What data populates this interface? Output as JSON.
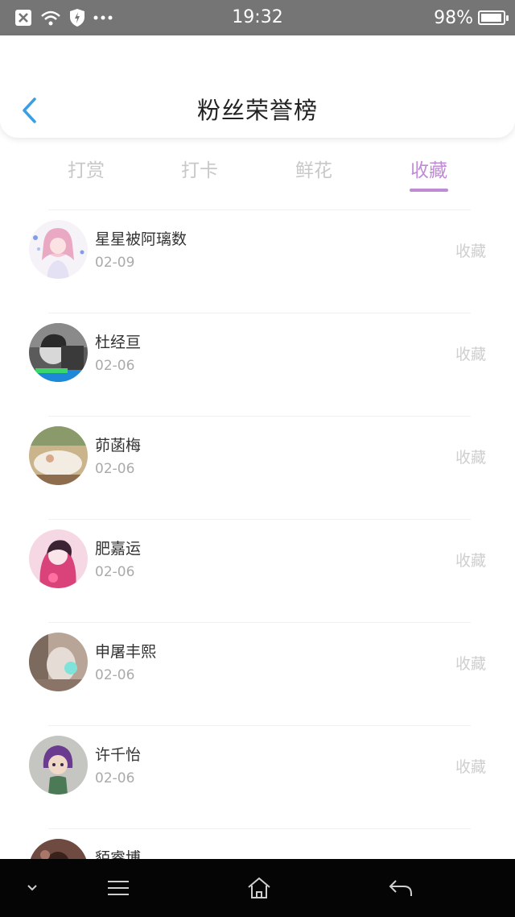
{
  "status_bar": {
    "time": "19:32",
    "battery_percent": "98%",
    "battery_level": 0.98,
    "icons": [
      "notification-x-icon",
      "wifi-icon",
      "shield-icon",
      "more-dots-icon"
    ]
  },
  "header": {
    "title": "粉丝荣誉榜",
    "back_icon": "chevron-left-icon"
  },
  "tabs": [
    {
      "label": "打赏",
      "active": false
    },
    {
      "label": "打卡",
      "active": false
    },
    {
      "label": "鲜花",
      "active": false
    },
    {
      "label": "收藏",
      "active": true
    }
  ],
  "list": [
    {
      "name": "星星被阿璃数",
      "date": "02-09",
      "action": "收藏"
    },
    {
      "name": "杜经亘",
      "date": "02-06",
      "action": "收藏"
    },
    {
      "name": "茆菡梅",
      "date": "02-06",
      "action": "收藏"
    },
    {
      "name": "肥嘉运",
      "date": "02-06",
      "action": "收藏"
    },
    {
      "name": "申屠丰熙",
      "date": "02-06",
      "action": "收藏"
    },
    {
      "name": "许千怡",
      "date": "02-06",
      "action": "收藏"
    },
    {
      "name": "貊睿博",
      "date": "",
      "action": ""
    }
  ],
  "colors": {
    "accent": "#c08bd6",
    "status_bar": "#757575",
    "back_arrow": "#3a9ee4",
    "nav_bar": "#050505"
  },
  "nav": {
    "icons": [
      "chevron-down-icon",
      "menu-icon",
      "home-icon",
      "back-arrow-icon"
    ]
  }
}
